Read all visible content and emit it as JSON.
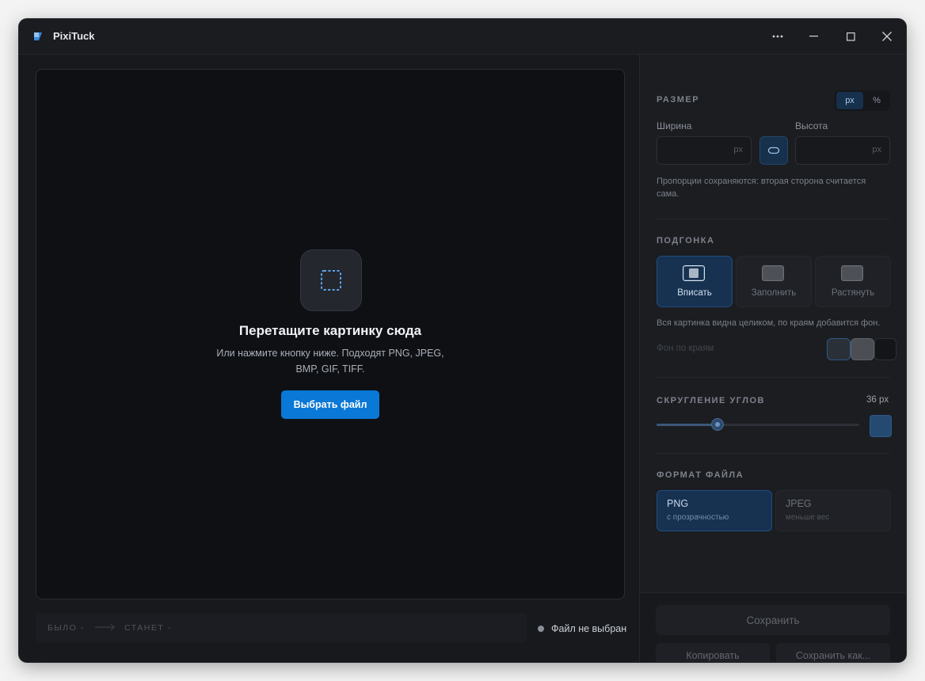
{
  "app": {
    "title": "PixiTuck"
  },
  "window_controls": {
    "more": "more-icon",
    "minimize": "minimize-icon",
    "maximize": "maximize-icon",
    "close": "close-icon"
  },
  "dropzone": {
    "title": "Перетащите картинку сюда",
    "subtitle": "Или нажмите кнопку ниже. Подходят PNG, JPEG, BMP, GIF, TIFF.",
    "button": "Выбрать файл"
  },
  "statusbar": {
    "was_label": "БЫЛО",
    "was_value": "-",
    "will_label": "СТАНЕТ",
    "will_value": "-",
    "file_status": "Файл не выбран"
  },
  "size": {
    "title": "РАЗМЕР",
    "units": [
      "px",
      "%"
    ],
    "selected_unit": "px",
    "width_label": "Ширина",
    "height_label": "Высота",
    "width_value": "",
    "height_value": "",
    "unit_suffix": "px",
    "hint": "Пропорции сохраняются: вторая сторона считается сама."
  },
  "fit": {
    "title": "ПОДГОНКА",
    "options": [
      {
        "label": "Вписать",
        "active": true
      },
      {
        "label": "Заполнить",
        "active": false
      },
      {
        "label": "Растянуть",
        "active": false
      }
    ],
    "hint": "Вся картинка видна целиком, по краям добавится фон.",
    "bg_label": "Фон по краям"
  },
  "corner": {
    "title": "СКРУГЛЕНИЕ УГЛОВ",
    "value_label": "36 px",
    "value": 36,
    "level": 0.3
  },
  "format": {
    "title": "ФОРМАТ ФАЙЛА",
    "options": [
      {
        "name": "PNG",
        "desc": "с прозрачностью",
        "active": true
      },
      {
        "name": "JPEG",
        "desc": "меньше вес",
        "active": false
      }
    ]
  },
  "footer": {
    "save": "Сохранить",
    "copy": "Копировать",
    "save_as": "Сохранить как..."
  },
  "colors": {
    "accent": "#0a78d6",
    "panel_bg": "#1b1d21",
    "canvas_bg": "#0e1014",
    "active_card": "#173150"
  }
}
